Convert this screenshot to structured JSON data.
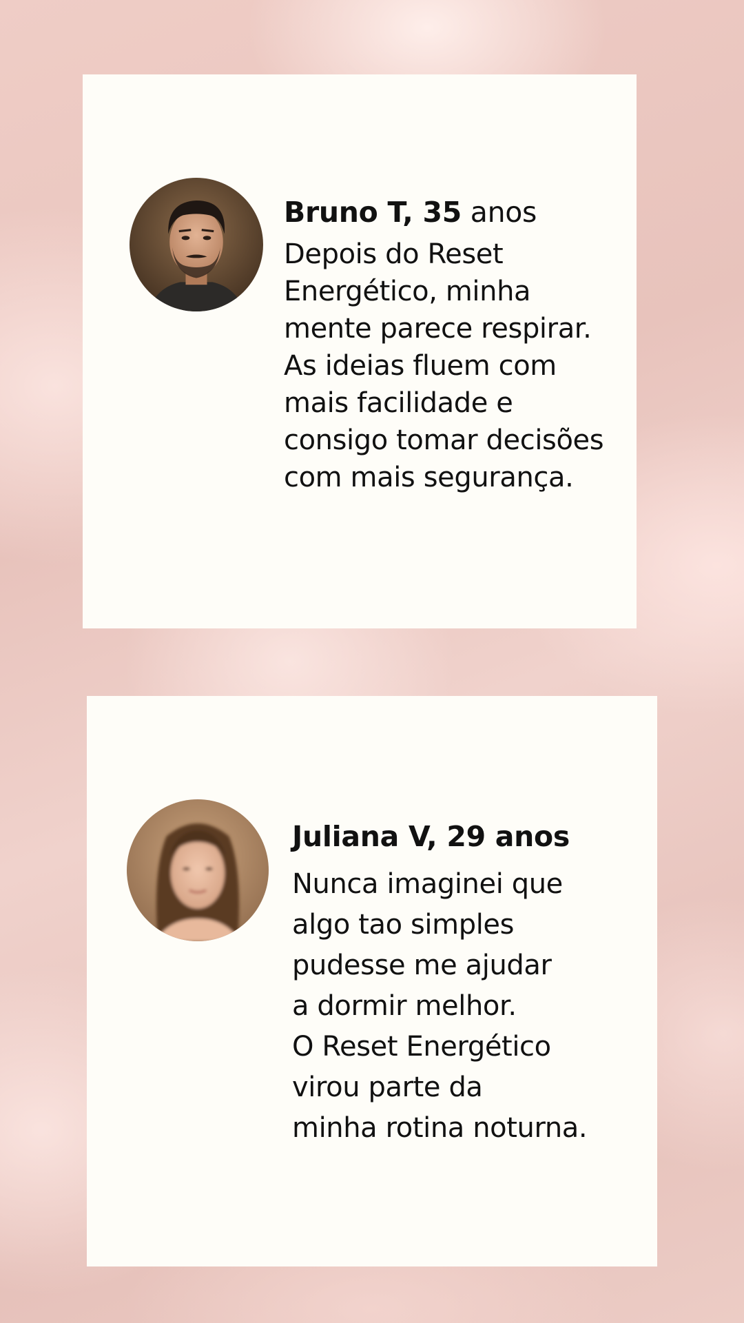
{
  "testimonials": [
    {
      "name_bold": "Bruno T, 35",
      "name_rest": " anos",
      "quote": "Depois do Reset\nEnergético, minha\nmente parece respirar.\nAs ideias fluem com\nmais facilidade e\nconsigo tomar decisões\ncom mais segurança.",
      "avatar_icon": "man-portrait-avatar"
    },
    {
      "name_bold": "Juliana V, 29 anos",
      "name_rest": "",
      "quote": "Nunca imaginei que\nalgo tao simples\npudesse me ajudar\na dormir melhor.\nO Reset Energético\nvirou parte da\nminha rotina noturna.",
      "avatar_icon": "woman-portrait-avatar"
    }
  ],
  "colors": {
    "background": "#ecc9c2",
    "card": "#fefdf8",
    "text": "#111111"
  }
}
